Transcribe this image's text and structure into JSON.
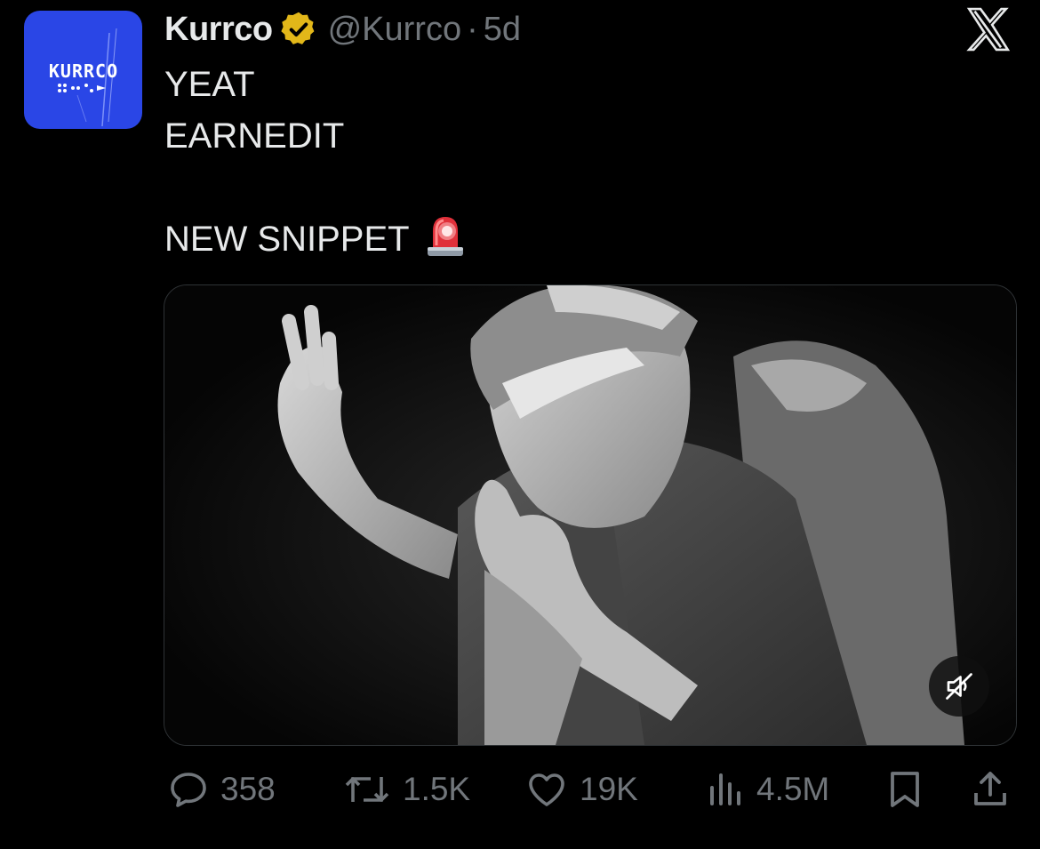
{
  "account": {
    "display_name": "Kurrco",
    "handle": "@Kurrco",
    "separator": "·",
    "time": "5d",
    "avatar_text": "KURRCO",
    "verified_color": "#e2b719"
  },
  "tweet": {
    "lines": [
      "YEAT",
      "EARNEDIT",
      "",
      "NEW SNIPPET"
    ],
    "emoji_icon": "siren-icon"
  },
  "media": {
    "type": "video",
    "muted": true,
    "mute_icon": "speaker-muted-icon"
  },
  "actions": {
    "replies": "358",
    "reposts": "1.5K",
    "likes": "19K",
    "views": "4.5M"
  },
  "colors": {
    "background": "#000000",
    "text": "#e7e9ea",
    "muted_text": "#71767b",
    "avatar_bg": "#2a46e6"
  }
}
